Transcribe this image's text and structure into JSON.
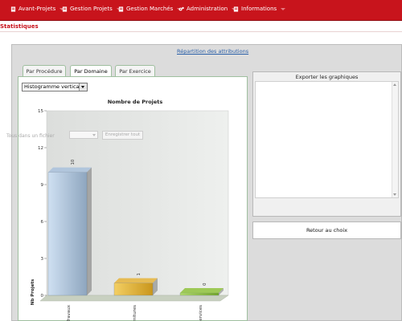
{
  "nav": {
    "items": [
      {
        "label": "Avant-Projets",
        "icon": "document-icon"
      },
      {
        "label": "Gestion Projets",
        "icon": "document-icon"
      },
      {
        "label": "Gestion Marchés",
        "icon": "document-icon"
      },
      {
        "label": "Administration",
        "icon": "gears-icon"
      },
      {
        "label": "Informations",
        "icon": "document-icon"
      }
    ]
  },
  "page": {
    "title": "Statistiques"
  },
  "repartition": {
    "link": "Répartition des attributions"
  },
  "tabs": [
    {
      "label": "Par Procédure",
      "active": false
    },
    {
      "label": "Par Domaine",
      "active": true
    },
    {
      "label": "Par Exercice",
      "active": false
    }
  ],
  "chart_type_select": {
    "value": "Histogramme vertical"
  },
  "chart_data": {
    "type": "bar",
    "title": "Nombre de Projets",
    "ylabel": "Nb Projets",
    "categories": [
      "Travaux",
      "Fournitures",
      "Services"
    ],
    "values": [
      10,
      1,
      0
    ],
    "data_labels": [
      "10",
      "1",
      "0"
    ],
    "yticks": [
      0,
      3,
      6,
      9,
      12,
      15
    ],
    "ylim": [
      0,
      15
    ],
    "colors": [
      "#a9c1dc",
      "#e6b43a",
      "#8fc23c"
    ]
  },
  "export": {
    "title": "Exporter les graphiques",
    "all_label": "Tous dans un fichier",
    "save_button": "Enregistrer tout"
  },
  "retour": {
    "label": "Retour au choix"
  },
  "colors": {
    "brand": "#c8141c",
    "tab_border": "#9fbf9f",
    "link": "#2a5fa8"
  }
}
